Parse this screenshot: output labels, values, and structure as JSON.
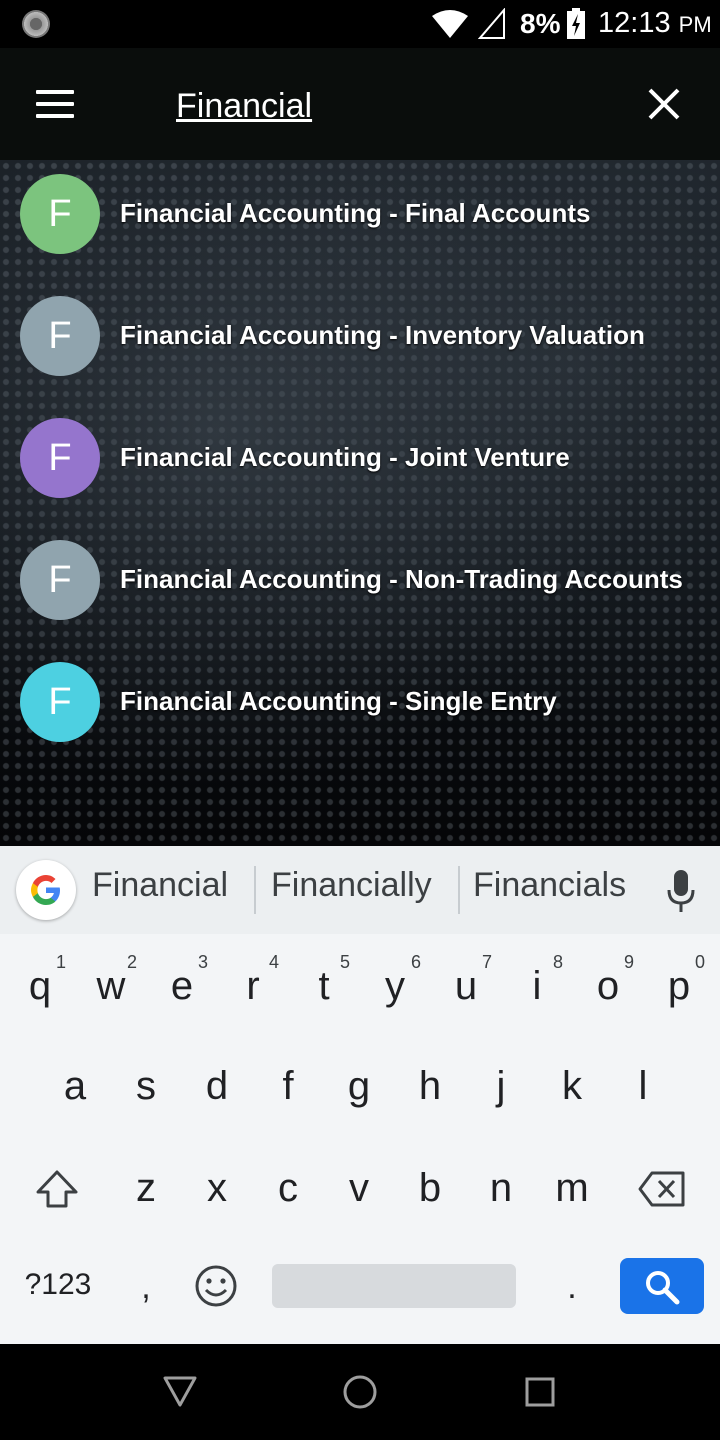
{
  "status_bar": {
    "battery_percent": "8%",
    "time": "12:13",
    "ampm": "PM"
  },
  "search": {
    "value": "Financial"
  },
  "results": [
    {
      "letter": "F",
      "color": "#7cc47e",
      "title": "Financial Accounting - Final Accounts"
    },
    {
      "letter": "F",
      "color": "#90a4ae",
      "title": "Financial Accounting - Inventory Valuation"
    },
    {
      "letter": "F",
      "color": "#9575cd",
      "title": "Financial Accounting - Joint Venture"
    },
    {
      "letter": "F",
      "color": "#90a4ae",
      "title": "Financial Accounting - Non-Trading Accounts"
    },
    {
      "letter": "F",
      "color": "#4dd0e1",
      "title": "Financial Accounting - Single Entry"
    }
  ],
  "keyboard": {
    "suggestions": [
      "Financial",
      "Financially",
      "Financials"
    ],
    "row1": [
      "q",
      "w",
      "e",
      "r",
      "t",
      "y",
      "u",
      "i",
      "o",
      "p"
    ],
    "row1_hints": [
      "1",
      "2",
      "3",
      "4",
      "5",
      "6",
      "7",
      "8",
      "9",
      "0"
    ],
    "row2": [
      "a",
      "s",
      "d",
      "f",
      "g",
      "h",
      "j",
      "k",
      "l"
    ],
    "row3": [
      "z",
      "x",
      "c",
      "v",
      "b",
      "n",
      "m"
    ],
    "symbols_label": "?123",
    "comma": ",",
    "period": "."
  },
  "colors": {
    "search_key": "#1a73e8",
    "app_bar": "#0a0d0c",
    "keyboard_bg": "#f3f5f7"
  },
  "icons": [
    "menu-icon",
    "close-icon",
    "google-icon",
    "mic-icon",
    "shift-icon",
    "backspace-icon",
    "emoji-icon",
    "search-icon",
    "back-icon",
    "home-icon",
    "recents-icon",
    "wifi-icon",
    "signal-icon",
    "battery-icon"
  ]
}
